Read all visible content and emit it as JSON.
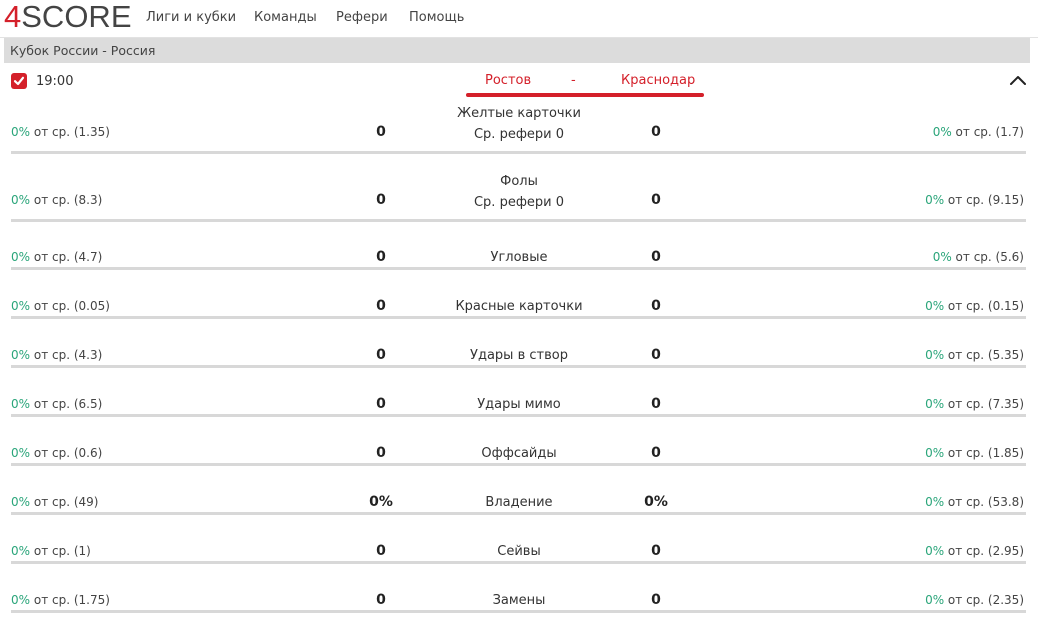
{
  "header": {
    "logo_digit": "4",
    "logo_word": "SCORE",
    "nav": [
      "Лиги и кубки",
      "Команды",
      "Рефери",
      "Помощь"
    ]
  },
  "league": {
    "title": "Кубок России - Россия"
  },
  "match": {
    "time": "19:00",
    "home": "Ростов",
    "separator": "-",
    "away": "Краснодар"
  },
  "colors": {
    "accent": "#d4202a",
    "percent": "#2aa57a",
    "bar": "#d8d8d8"
  },
  "stats": [
    {
      "label": "Желтые карточки",
      "sub": "Ср. рефери 0",
      "home": "0",
      "away": "0",
      "home_pct": "0%",
      "home_avg": " от ср. (1.35)",
      "away_pct": "0%",
      "away_avg": " от ср. (1.7)"
    },
    {
      "label": "Фолы",
      "sub": "Ср. рефери 0",
      "home": "0",
      "away": "0",
      "home_pct": "0%",
      "home_avg": " от ср. (8.3)",
      "away_pct": "0%",
      "away_avg": " от ср. (9.15)"
    },
    {
      "label": "Угловые",
      "home": "0",
      "away": "0",
      "home_pct": "0%",
      "home_avg": " от ср. (4.7)",
      "away_pct": "0%",
      "away_avg": " от ср. (5.6)"
    },
    {
      "label": "Красные карточки",
      "home": "0",
      "away": "0",
      "home_pct": "0%",
      "home_avg": " от ср. (0.05)",
      "away_pct": "0%",
      "away_avg": " от ср. (0.15)"
    },
    {
      "label": "Удары в створ",
      "home": "0",
      "away": "0",
      "home_pct": "0%",
      "home_avg": " от ср. (4.3)",
      "away_pct": "0%",
      "away_avg": " от ср. (5.35)"
    },
    {
      "label": "Удары мимо",
      "home": "0",
      "away": "0",
      "home_pct": "0%",
      "home_avg": " от ср. (6.5)",
      "away_pct": "0%",
      "away_avg": " от ср. (7.35)"
    },
    {
      "label": "Оффсайды",
      "home": "0",
      "away": "0",
      "home_pct": "0%",
      "home_avg": " от ср. (0.6)",
      "away_pct": "0%",
      "away_avg": " от ср. (1.85)"
    },
    {
      "label": "Владение",
      "home": "0%",
      "away": "0%",
      "home_pct": "0%",
      "home_avg": " от ср. (49)",
      "away_pct": "0%",
      "away_avg": " от ср. (53.8)"
    },
    {
      "label": "Сейвы",
      "home": "0",
      "away": "0",
      "home_pct": "0%",
      "home_avg": " от ср. (1)",
      "away_pct": "0%",
      "away_avg": " от ср. (2.95)"
    },
    {
      "label": "Замены",
      "home": "0",
      "away": "0",
      "home_pct": "0%",
      "home_avg": " от ср. (1.75)",
      "away_pct": "0%",
      "away_avg": " от ср. (2.35)"
    }
  ]
}
